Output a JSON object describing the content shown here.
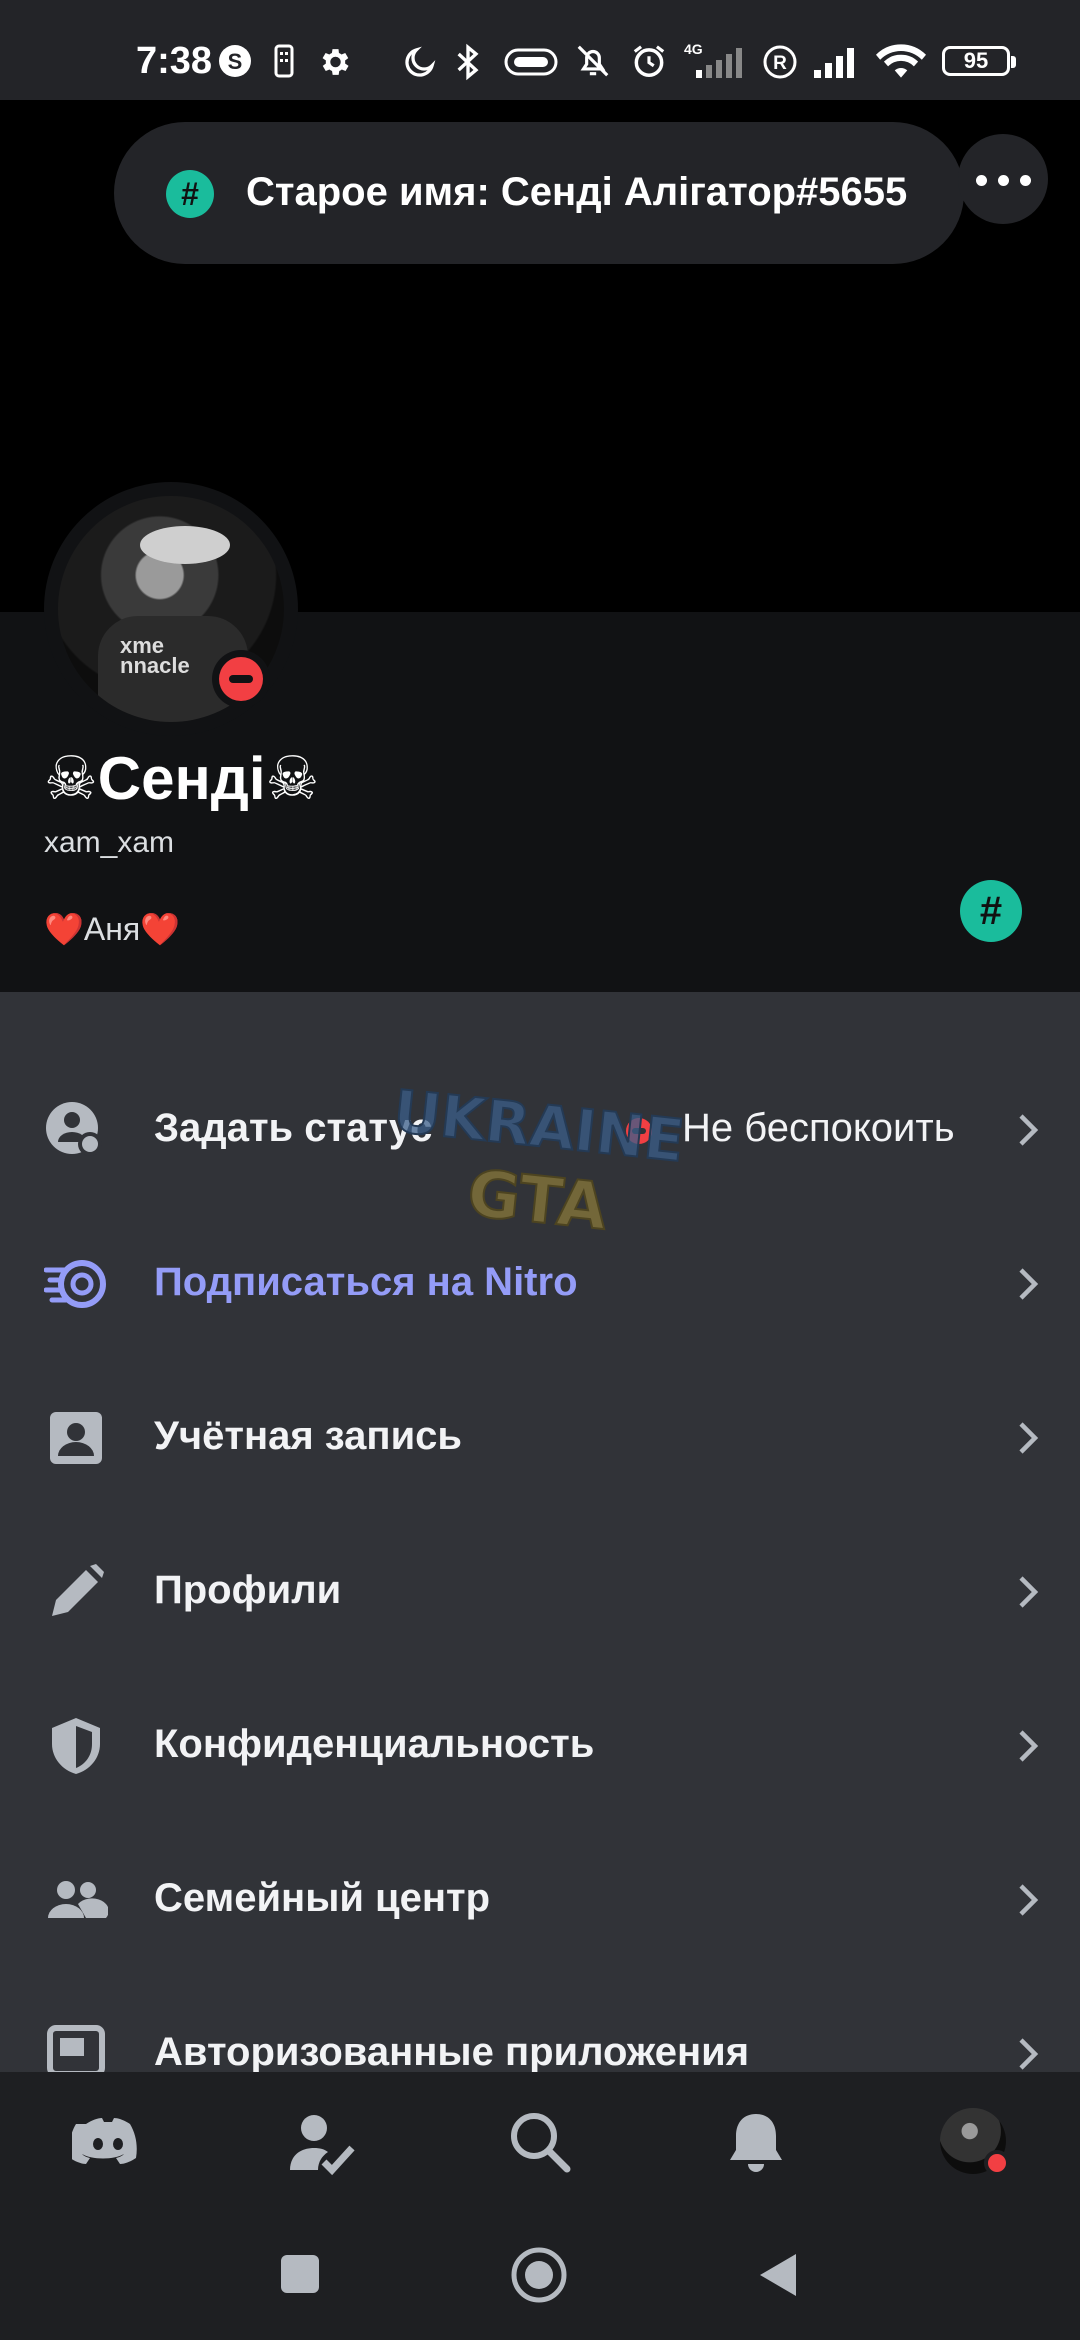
{
  "status_bar": {
    "time": "7:38",
    "network": "4G",
    "battery": "95"
  },
  "header": {
    "tag_text": "Старое имя: Сенді Алігатор#5655",
    "hash_symbol": "#"
  },
  "profile": {
    "display_name": "☠Сенді☠",
    "username": "xam_xam",
    "bio": "❤️Аня❤️",
    "avatar_shirt_text": "xme\nnnacle"
  },
  "settings": [
    {
      "label": "Задать статус",
      "value": "Не беспокоить",
      "icon": "status-icon"
    },
    {
      "label": "Подписаться на Nitro",
      "icon": "nitro-icon",
      "accent": "#949cf7"
    },
    {
      "label": "Учётная запись",
      "icon": "account-icon"
    },
    {
      "label": "Профили",
      "icon": "pencil-icon"
    },
    {
      "label": "Конфиденциальность",
      "icon": "shield-icon"
    },
    {
      "label": "Семейный центр",
      "icon": "family-icon"
    },
    {
      "label": "Авторизованные приложения",
      "icon": "apps-icon"
    }
  ],
  "watermark": {
    "line1": "UKRAINE",
    "line2": "GTA"
  },
  "bottom_nav": [
    "home-icon",
    "friends-icon",
    "search-icon",
    "bell-icon",
    "profile-avatar"
  ],
  "colors": {
    "background": "#313338",
    "banner": "#000000",
    "profile_bg": "#111214",
    "accent_green": "#1abc9c",
    "dnd_red": "#f23f43",
    "nitro_purple": "#949cf7"
  }
}
